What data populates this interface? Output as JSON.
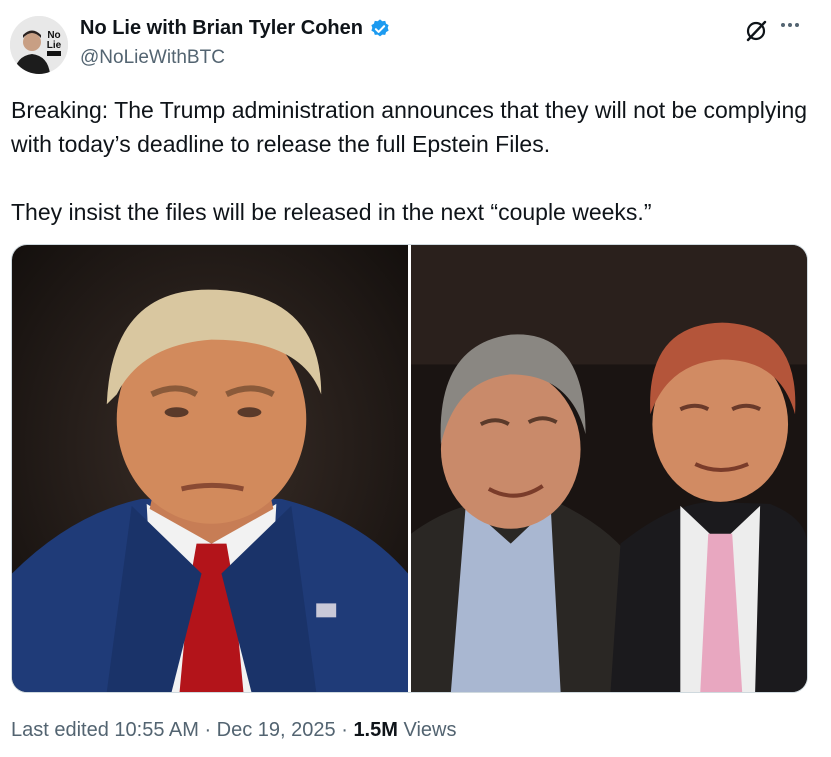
{
  "author": {
    "display_name": "No Lie with Brian Tyler Cohen",
    "handle": "@NoLieWithBTC",
    "avatar_text": "No Lie",
    "verified": true
  },
  "post": {
    "text_line1": "Breaking: The Trump administration announces that they will not be complying with today’s deadline to release the full Epstein Files.",
    "text_line2": "They insist the files will be released in the next “couple weeks.”"
  },
  "media": {
    "images": [
      {
        "alt": "photo-left"
      },
      {
        "alt": "photo-right"
      }
    ]
  },
  "meta": {
    "edited": "Last edited 10:55 AM · Dec 19, 2025 · ",
    "views_count": "1.5M",
    "views_label": " Views"
  },
  "colors": {
    "text": "#0f1419",
    "secondary": "#536471",
    "verified": "#1d9bf0",
    "border": "#cfd9de"
  },
  "icons": [
    "verified-badge-icon",
    "grok-icon",
    "more-icon"
  ]
}
